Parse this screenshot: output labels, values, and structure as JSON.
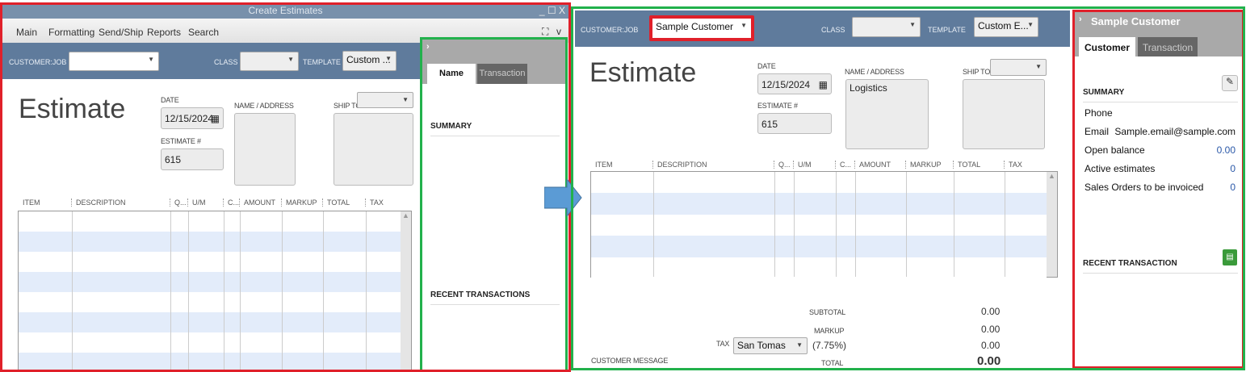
{
  "left": {
    "window_title": "Create Estimates",
    "menu": [
      "Main",
      "Formatting",
      "Send/Ship",
      "Reports",
      "Search"
    ],
    "customer_job_label": "CUSTOMER:JOB",
    "customer_job_value": "",
    "class_label": "CLASS",
    "template_label": "TEMPLATE",
    "template_value": "Custom ...",
    "heading": "Estimate",
    "date_label": "DATE",
    "date_value": "12/15/2024",
    "estimate_no_label": "ESTIMATE #",
    "estimate_no_value": "615",
    "name_address_label": "NAME / ADDRESS",
    "ship_to_label": "SHIP TO",
    "columns": [
      "ITEM",
      "DESCRIPTION",
      "Q...",
      "U/M",
      "C...",
      "AMOUNT",
      "MARKUP",
      "TOTAL",
      "TAX"
    ],
    "pane": {
      "tabs": [
        "Name",
        "Transaction"
      ],
      "summary": "SUMMARY",
      "recent": "RECENT TRANSACTIONS"
    }
  },
  "right": {
    "customer_job_label": "CUSTOMER:JOB",
    "customer_job_value": "Sample Customer",
    "class_label": "CLASS",
    "template_label": "TEMPLATE",
    "template_value": "Custom E...",
    "heading": "Estimate",
    "date_label": "DATE",
    "date_value": "12/15/2024",
    "estimate_no_label": "ESTIMATE #",
    "estimate_no_value": "615",
    "name_address_label": "NAME / ADDRESS",
    "name_address_value": "Logistics",
    "ship_to_label": "SHIP TO",
    "columns": [
      "ITEM",
      "DESCRIPTION",
      "Q...",
      "U/M",
      "C...",
      "AMOUNT",
      "MARKUP",
      "TOTAL",
      "TAX"
    ],
    "subtotal_label": "SUBTOTAL",
    "subtotal": "0.00",
    "markup_label": "MARKUP",
    "markup": "0.00",
    "tax_label": "TAX",
    "tax_value": "San Tomas",
    "tax_rate": "(7.75%)",
    "tax": "0.00",
    "customer_message_label": "CUSTOMER MESSAGE",
    "total_label": "TOTAL",
    "total": "0.00",
    "pane": {
      "title": "Sample Customer",
      "tabs": [
        "Customer",
        "Transaction"
      ],
      "summary": "SUMMARY",
      "rows": [
        {
          "k": "Phone",
          "v": ""
        },
        {
          "k": "Email",
          "v": "Sample.email@sample.com"
        },
        {
          "k": "Open balance",
          "v": "0.00"
        },
        {
          "k": "Active estimates",
          "v": "0"
        },
        {
          "k": "Sales Orders to be invoiced",
          "v": "0"
        }
      ],
      "recent": "RECENT TRANSACTION"
    }
  }
}
